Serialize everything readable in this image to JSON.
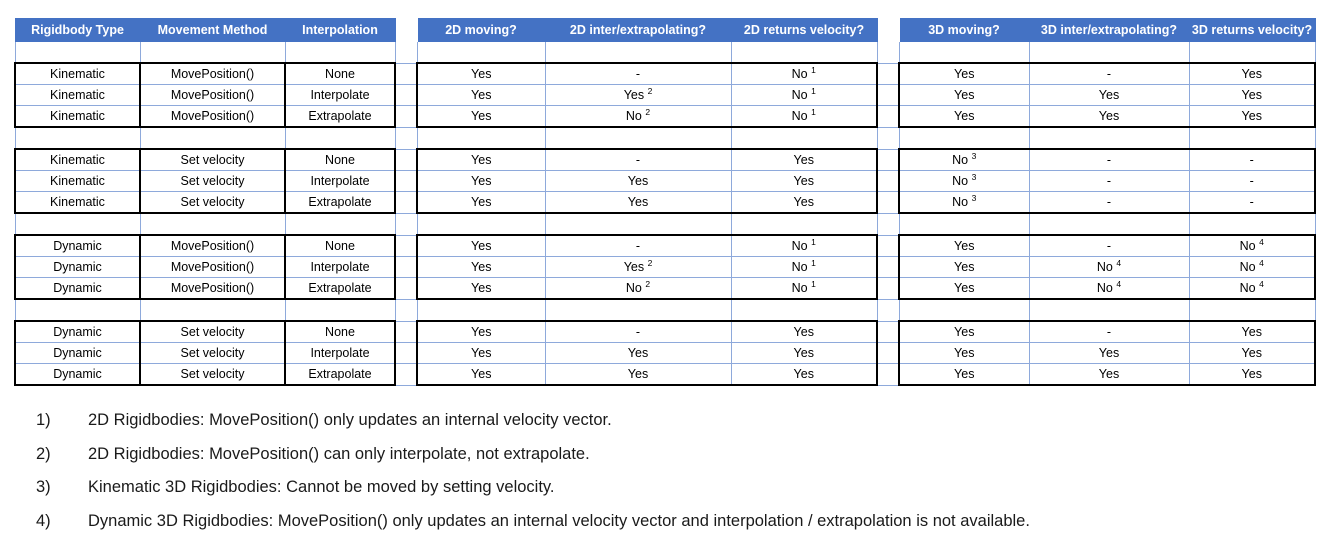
{
  "table": {
    "columns": [
      {
        "key": "rigidbody_type",
        "label": "Rigidbody Type"
      },
      {
        "key": "movement_method",
        "label": "Movement Method"
      },
      {
        "key": "interpolation",
        "label": "Interpolation"
      },
      {
        "key": "gap1",
        "label": ""
      },
      {
        "key": "moving_2d",
        "label": "2D moving?"
      },
      {
        "key": "interp_2d",
        "label": "2D inter/extrapolating?"
      },
      {
        "key": "returns_velocity_2d",
        "label": "2D returns velocity?"
      },
      {
        "key": "gap2",
        "label": ""
      },
      {
        "key": "moving_3d",
        "label": "3D moving?"
      },
      {
        "key": "interp_3d",
        "label": "3D inter/extrapolating?"
      },
      {
        "key": "returns_velocity_3d",
        "label": "3D returns velocity?"
      }
    ],
    "blocks": [
      {
        "rows": [
          {
            "rigidbody_type": "Kinematic",
            "movement_method": "MovePosition()",
            "interpolation": "None",
            "moving_2d": "Yes",
            "interp_2d": "-",
            "returns_velocity_2d": "No",
            "returns_velocity_2d_note": "1",
            "moving_3d": "Yes",
            "interp_3d": "-",
            "returns_velocity_3d": "Yes"
          },
          {
            "rigidbody_type": "Kinematic",
            "movement_method": "MovePosition()",
            "interpolation": "Interpolate",
            "moving_2d": "Yes",
            "interp_2d": "Yes",
            "interp_2d_note": "2",
            "returns_velocity_2d": "No",
            "returns_velocity_2d_note": "1",
            "moving_3d": "Yes",
            "interp_3d": "Yes",
            "returns_velocity_3d": "Yes"
          },
          {
            "rigidbody_type": "Kinematic",
            "movement_method": "MovePosition()",
            "interpolation": "Extrapolate",
            "moving_2d": "Yes",
            "interp_2d": "No",
            "interp_2d_note": "2",
            "returns_velocity_2d": "No",
            "returns_velocity_2d_note": "1",
            "moving_3d": "Yes",
            "interp_3d": "Yes",
            "returns_velocity_3d": "Yes"
          }
        ]
      },
      {
        "rows": [
          {
            "rigidbody_type": "Kinematic",
            "movement_method": "Set velocity",
            "interpolation": "None",
            "moving_2d": "Yes",
            "interp_2d": "-",
            "returns_velocity_2d": "Yes",
            "moving_3d": "No",
            "moving_3d_note": "3",
            "interp_3d": "-",
            "returns_velocity_3d": "-"
          },
          {
            "rigidbody_type": "Kinematic",
            "movement_method": "Set velocity",
            "interpolation": "Interpolate",
            "moving_2d": "Yes",
            "interp_2d": "Yes",
            "returns_velocity_2d": "Yes",
            "moving_3d": "No",
            "moving_3d_note": "3",
            "interp_3d": "-",
            "returns_velocity_3d": "-"
          },
          {
            "rigidbody_type": "Kinematic",
            "movement_method": "Set velocity",
            "interpolation": "Extrapolate",
            "moving_2d": "Yes",
            "interp_2d": "Yes",
            "returns_velocity_2d": "Yes",
            "moving_3d": "No",
            "moving_3d_note": "3",
            "interp_3d": "-",
            "returns_velocity_3d": "-"
          }
        ]
      },
      {
        "rows": [
          {
            "rigidbody_type": "Dynamic",
            "movement_method": "MovePosition()",
            "interpolation": "None",
            "moving_2d": "Yes",
            "interp_2d": "-",
            "returns_velocity_2d": "No",
            "returns_velocity_2d_note": "1",
            "moving_3d": "Yes",
            "interp_3d": "-",
            "returns_velocity_3d": "No",
            "returns_velocity_3d_note": "4"
          },
          {
            "rigidbody_type": "Dynamic",
            "movement_method": "MovePosition()",
            "interpolation": "Interpolate",
            "moving_2d": "Yes",
            "interp_2d": "Yes",
            "interp_2d_note": "2",
            "returns_velocity_2d": "No",
            "returns_velocity_2d_note": "1",
            "moving_3d": "Yes",
            "interp_3d": "No",
            "interp_3d_note": "4",
            "returns_velocity_3d": "No",
            "returns_velocity_3d_note": "4"
          },
          {
            "rigidbody_type": "Dynamic",
            "movement_method": "MovePosition()",
            "interpolation": "Extrapolate",
            "moving_2d": "Yes",
            "interp_2d": "No",
            "interp_2d_note": "2",
            "returns_velocity_2d": "No",
            "returns_velocity_2d_note": "1",
            "moving_3d": "Yes",
            "interp_3d": "No",
            "interp_3d_note": "4",
            "returns_velocity_3d": "No",
            "returns_velocity_3d_note": "4"
          }
        ]
      },
      {
        "rows": [
          {
            "rigidbody_type": "Dynamic",
            "movement_method": "Set velocity",
            "interpolation": "None",
            "moving_2d": "Yes",
            "interp_2d": "-",
            "returns_velocity_2d": "Yes",
            "moving_3d": "Yes",
            "interp_3d": "-",
            "returns_velocity_3d": "Yes"
          },
          {
            "rigidbody_type": "Dynamic",
            "movement_method": "Set velocity",
            "interpolation": "Interpolate",
            "moving_2d": "Yes",
            "interp_2d": "Yes",
            "returns_velocity_2d": "Yes",
            "moving_3d": "Yes",
            "interp_3d": "Yes",
            "returns_velocity_3d": "Yes"
          },
          {
            "rigidbody_type": "Dynamic",
            "movement_method": "Set velocity",
            "interpolation": "Extrapolate",
            "moving_2d": "Yes",
            "interp_2d": "Yes",
            "returns_velocity_2d": "Yes",
            "moving_3d": "Yes",
            "interp_3d": "Yes",
            "returns_velocity_3d": "Yes"
          }
        ]
      }
    ]
  },
  "footnotes": [
    {
      "num": "1)",
      "text": "2D Rigidbodies: MovePosition() only updates an internal velocity vector."
    },
    {
      "num": "2)",
      "text": "2D Rigidbodies: MovePosition() can only interpolate, not extrapolate."
    },
    {
      "num": "3)",
      "text": "Kinematic 3D Rigidbodies: Cannot be moved by setting velocity."
    },
    {
      "num": "4)",
      "text": "Dynamic 3D Rigidbodies: MovePosition() only updates an internal velocity vector and interpolation / extrapolation is not available."
    }
  ],
  "colors": {
    "header_background": "#4472c4",
    "header_text": "#ffffff",
    "grid_line": "#8ea9db",
    "block_border": "#000000",
    "body_text": "#000000"
  }
}
